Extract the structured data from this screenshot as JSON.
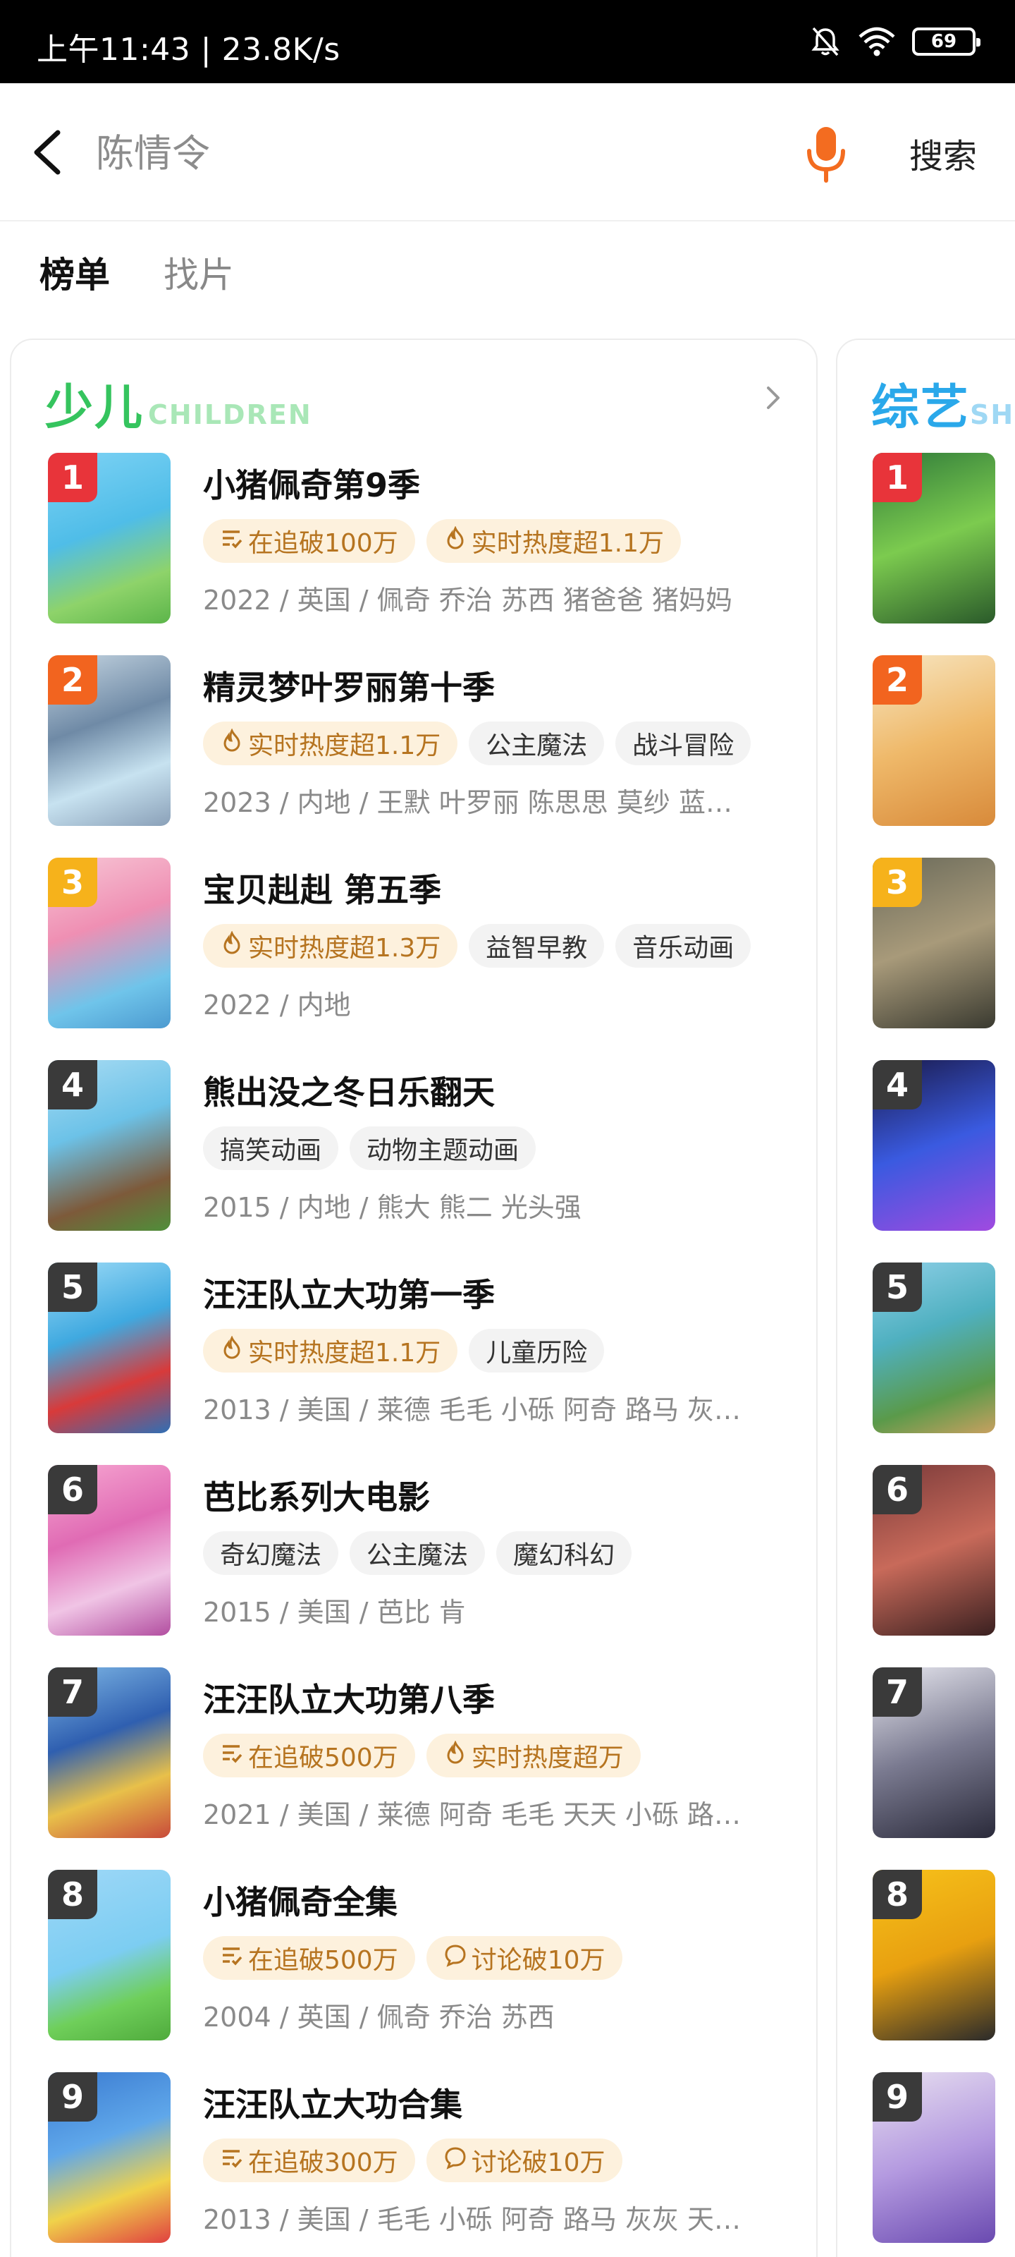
{
  "status_bar": {
    "time": "上午11:43 | 23.8K/s",
    "battery": "69"
  },
  "search": {
    "placeholder": "陈情令",
    "button_label": "搜索"
  },
  "tabs": [
    {
      "label": "榜单",
      "active": true
    },
    {
      "label": "找片",
      "active": false
    }
  ],
  "card_children": {
    "title": "少儿",
    "subtitle": "CHILDREN",
    "items": [
      {
        "rank": "1",
        "title": "小猪佩奇第9季",
        "tags": [
          {
            "icon": "list-icon",
            "text": "在追破100万",
            "hot": true
          },
          {
            "icon": "flame-icon",
            "text": "实时热度超1.1万",
            "hot": true
          }
        ],
        "meta": "2022 / 英国 / 佩奇 乔治 苏西 猪爸爸 猪妈妈"
      },
      {
        "rank": "2",
        "title": "精灵梦叶罗丽第十季",
        "tags": [
          {
            "icon": "flame-icon",
            "text": "实时热度超1.1万",
            "hot": true
          },
          {
            "text": "公主魔法",
            "hot": false
          },
          {
            "text": "战斗冒险",
            "hot": false
          }
        ],
        "meta": "2023 / 内地 / 王默 叶罗丽 陈思思 莫纱 蓝…"
      },
      {
        "rank": "3",
        "title": "宝贝赳赳 第五季",
        "tags": [
          {
            "icon": "flame-icon",
            "text": "实时热度超1.3万",
            "hot": true
          },
          {
            "text": "益智早教",
            "hot": false
          },
          {
            "text": "音乐动画",
            "hot": false
          }
        ],
        "meta": "2022 / 内地"
      },
      {
        "rank": "4",
        "title": "熊出没之冬日乐翻天",
        "tags": [
          {
            "text": "搞笑动画",
            "hot": false
          },
          {
            "text": "动物主题动画",
            "hot": false
          }
        ],
        "meta": "2015 / 内地 / 熊大 熊二 光头强"
      },
      {
        "rank": "5",
        "title": "汪汪队立大功第一季",
        "tags": [
          {
            "icon": "flame-icon",
            "text": "实时热度超1.1万",
            "hot": true
          },
          {
            "text": "儿童历险",
            "hot": false
          }
        ],
        "meta": "2013 / 美国 / 莱德 毛毛 小砾 阿奇 路马 灰…"
      },
      {
        "rank": "6",
        "title": "芭比系列大电影",
        "tags": [
          {
            "text": "奇幻魔法",
            "hot": false
          },
          {
            "text": "公主魔法",
            "hot": false
          },
          {
            "text": "魔幻科幻",
            "hot": false
          }
        ],
        "meta": "2015 / 美国 / 芭比 肯"
      },
      {
        "rank": "7",
        "title": "汪汪队立大功第八季",
        "tags": [
          {
            "icon": "list-icon",
            "text": "在追破500万",
            "hot": true
          },
          {
            "icon": "flame-icon",
            "text": "实时热度超万",
            "hot": true
          }
        ],
        "meta": "2021 / 美国 / 莱德 阿奇 毛毛 天天 小砾 路…"
      },
      {
        "rank": "8",
        "title": "小猪佩奇全集",
        "tags": [
          {
            "icon": "list-icon",
            "text": "在追破500万",
            "hot": true
          },
          {
            "icon": "chat-icon",
            "text": "讨论破10万",
            "hot": true
          }
        ],
        "meta": "2004 / 英国 / 佩奇 乔治 苏西"
      },
      {
        "rank": "9",
        "title": "汪汪队立大功合集",
        "tags": [
          {
            "icon": "list-icon",
            "text": "在追破300万",
            "hot": true
          },
          {
            "icon": "chat-icon",
            "text": "讨论破10万",
            "hot": true
          }
        ],
        "meta": "2013 / 美国 / 毛毛 小砾 阿奇 路马 灰灰 天…"
      }
    ]
  },
  "card_variety": {
    "title": "综艺",
    "subtitle": "SH",
    "ranks": [
      "1",
      "2",
      "3",
      "4",
      "5",
      "6",
      "7",
      "8",
      "9"
    ]
  },
  "colors": {
    "rank_1": "#e8343a",
    "rank_2": "#f2641f",
    "rank_3": "#f6b21b",
    "rank_other": "#3a3a3a",
    "children_accent": "#35c45e",
    "variety_accent": "#2aa8ea",
    "hot_tag_bg": "#fdf1dd",
    "hot_tag_text": "#b67420"
  }
}
